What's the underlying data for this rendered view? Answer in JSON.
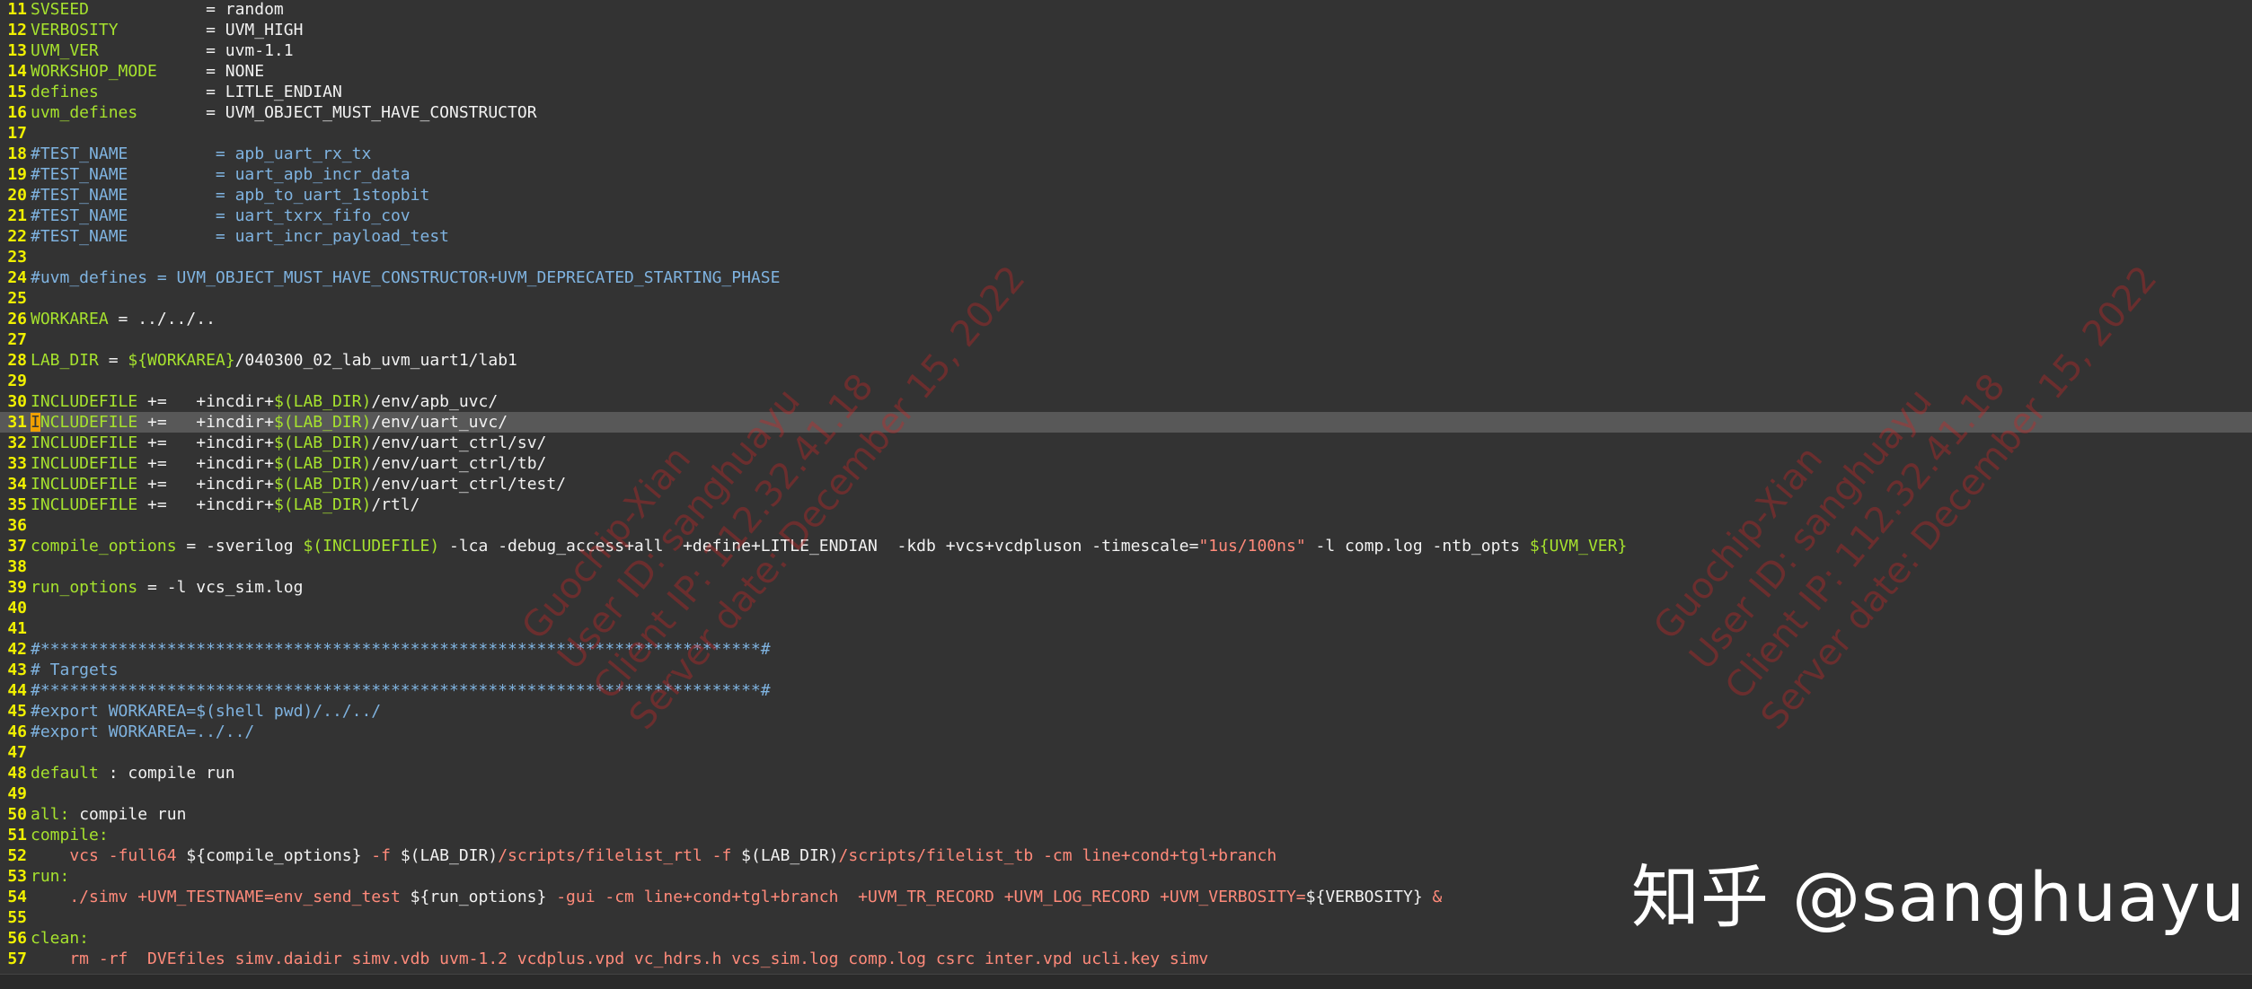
{
  "editor": {
    "cursor_line": 31,
    "lines": [
      {
        "n": "11",
        "segs": [
          [
            "k",
            "SVSEED"
          ],
          [
            "w",
            "            = random"
          ]
        ]
      },
      {
        "n": "12",
        "segs": [
          [
            "k",
            "VERBOSITY"
          ],
          [
            "w",
            "         = UVM_HIGH"
          ]
        ]
      },
      {
        "n": "13",
        "segs": [
          [
            "k",
            "UVM_VER"
          ],
          [
            "w",
            "           = uvm-1.1"
          ]
        ]
      },
      {
        "n": "14",
        "segs": [
          [
            "k",
            "WORKSHOP_MODE"
          ],
          [
            "w",
            "     = NONE"
          ]
        ]
      },
      {
        "n": "15",
        "segs": [
          [
            "k",
            "defines"
          ],
          [
            "w",
            "           = LITLE_ENDIAN"
          ]
        ]
      },
      {
        "n": "16",
        "segs": [
          [
            "k",
            "uvm_defines"
          ],
          [
            "w",
            "       = UVM_OBJECT_MUST_HAVE_CONSTRUCTOR"
          ]
        ]
      },
      {
        "n": "17",
        "segs": []
      },
      {
        "n": "18",
        "segs": [
          [
            "c",
            "#TEST_NAME         = apb_uart_rx_tx"
          ]
        ]
      },
      {
        "n": "19",
        "segs": [
          [
            "c",
            "#TEST_NAME         = uart_apb_incr_data"
          ]
        ]
      },
      {
        "n": "20",
        "segs": [
          [
            "c",
            "#TEST_NAME         = apb_to_uart_1stopbit"
          ]
        ]
      },
      {
        "n": "21",
        "segs": [
          [
            "c",
            "#TEST_NAME         = uart_txrx_fifo_cov"
          ]
        ]
      },
      {
        "n": "22",
        "segs": [
          [
            "c",
            "#TEST_NAME         = uart_incr_payload_test"
          ]
        ]
      },
      {
        "n": "23",
        "segs": []
      },
      {
        "n": "24",
        "segs": [
          [
            "c",
            "#uvm_defines = UVM_OBJECT_MUST_HAVE_CONSTRUCTOR+UVM_DEPRECATED_STARTING_PHASE"
          ]
        ]
      },
      {
        "n": "25",
        "segs": []
      },
      {
        "n": "26",
        "segs": [
          [
            "k",
            "WORKAREA"
          ],
          [
            "w",
            " = ../../.."
          ]
        ]
      },
      {
        "n": "27",
        "segs": []
      },
      {
        "n": "28",
        "segs": [
          [
            "k",
            "LAB_DIR"
          ],
          [
            "w",
            " = "
          ],
          [
            "v",
            "${WORKAREA}"
          ],
          [
            "w",
            "/040300_02_lab_uvm_uart1/lab1"
          ]
        ]
      },
      {
        "n": "29",
        "segs": []
      },
      {
        "n": "30",
        "segs": [
          [
            "k",
            "INCLUDEFILE"
          ],
          [
            "w",
            " +=   +incdir+"
          ],
          [
            "v",
            "$(LAB_DIR)"
          ],
          [
            "w",
            "/env/apb_uvc/"
          ]
        ]
      },
      {
        "n": "31",
        "segs": [
          [
            "cursor",
            "I"
          ],
          [
            "k",
            "NCLUDEFILE"
          ],
          [
            "w",
            " +=   +incdir+"
          ],
          [
            "v",
            "$(LAB_DIR)"
          ],
          [
            "w",
            "/env/uart_uvc/"
          ]
        ]
      },
      {
        "n": "32",
        "segs": [
          [
            "k",
            "INCLUDEFILE"
          ],
          [
            "w",
            " +=   +incdir+"
          ],
          [
            "v",
            "$(LAB_DIR)"
          ],
          [
            "w",
            "/env/uart_ctrl/sv/"
          ]
        ]
      },
      {
        "n": "33",
        "segs": [
          [
            "k",
            "INCLUDEFILE"
          ],
          [
            "w",
            " +=   +incdir+"
          ],
          [
            "v",
            "$(LAB_DIR)"
          ],
          [
            "w",
            "/env/uart_ctrl/tb/"
          ]
        ]
      },
      {
        "n": "34",
        "segs": [
          [
            "k",
            "INCLUDEFILE"
          ],
          [
            "w",
            " +=   +incdir+"
          ],
          [
            "v",
            "$(LAB_DIR)"
          ],
          [
            "w",
            "/env/uart_ctrl/test/"
          ]
        ]
      },
      {
        "n": "35",
        "segs": [
          [
            "k",
            "INCLUDEFILE"
          ],
          [
            "w",
            " +=   +incdir+"
          ],
          [
            "v",
            "$(LAB_DIR)"
          ],
          [
            "w",
            "/rtl/"
          ]
        ]
      },
      {
        "n": "36",
        "segs": []
      },
      {
        "n": "37",
        "segs": [
          [
            "k",
            "compile_options"
          ],
          [
            "w",
            " = -sverilog "
          ],
          [
            "v",
            "$(INCLUDEFILE)"
          ],
          [
            "w",
            " -lca -debug_access+all  +define+LITLE_ENDIAN  -kdb +vcs+vcdpluson -timescale="
          ],
          [
            "s",
            "\"1us/100ns\""
          ],
          [
            "w",
            " -l comp.log -ntb_opts "
          ],
          [
            "v",
            "${UVM_VER}"
          ]
        ]
      },
      {
        "n": "38",
        "segs": []
      },
      {
        "n": "39",
        "segs": [
          [
            "k",
            "run_options"
          ],
          [
            "w",
            " = -l vcs_sim.log"
          ]
        ]
      },
      {
        "n": "40",
        "segs": []
      },
      {
        "n": "41",
        "segs": []
      },
      {
        "n": "42",
        "segs": [
          [
            "c",
            "#**************************************************************************#"
          ]
        ]
      },
      {
        "n": "43",
        "segs": [
          [
            "c",
            "# Targets"
          ]
        ]
      },
      {
        "n": "44",
        "segs": [
          [
            "c",
            "#**************************************************************************#"
          ]
        ]
      },
      {
        "n": "45",
        "segs": [
          [
            "c",
            "#export WORKAREA=$(shell pwd)/../../"
          ]
        ]
      },
      {
        "n": "46",
        "segs": [
          [
            "c",
            "#export WORKAREA=../../"
          ]
        ]
      },
      {
        "n": "47",
        "segs": []
      },
      {
        "n": "48",
        "segs": [
          [
            "k",
            "default"
          ],
          [
            "w",
            " : compile run"
          ]
        ]
      },
      {
        "n": "49",
        "segs": []
      },
      {
        "n": "50",
        "segs": [
          [
            "k",
            "all:"
          ],
          [
            "w",
            " compile run"
          ]
        ]
      },
      {
        "n": "51",
        "segs": [
          [
            "k",
            "compile:"
          ]
        ]
      },
      {
        "n": "52",
        "segs": [
          [
            "r",
            "    vcs -full64 "
          ],
          [
            "w",
            "${compile_options}"
          ],
          [
            "r",
            " -f "
          ],
          [
            "w",
            "$(LAB_DIR)"
          ],
          [
            "r",
            "/scripts/filelist_rtl -f "
          ],
          [
            "w",
            "$(LAB_DIR)"
          ],
          [
            "r",
            "/scripts/filelist_tb -cm line+cond+tgl+branch"
          ]
        ]
      },
      {
        "n": "53",
        "segs": [
          [
            "k",
            "run:"
          ]
        ]
      },
      {
        "n": "54",
        "segs": [
          [
            "r",
            "    ./simv +UVM_TESTNAME=env_send_test "
          ],
          [
            "w",
            "${run_options}"
          ],
          [
            "r",
            " -gui -cm line+cond+tgl+branch  +UVM_TR_RECORD +UVM_LOG_RECORD +UVM_VERBOSITY="
          ],
          [
            "w",
            "${VERBOSITY}"
          ],
          [
            "r",
            " &"
          ]
        ]
      },
      {
        "n": "55",
        "segs": []
      },
      {
        "n": "56",
        "segs": [
          [
            "k",
            "clean:"
          ]
        ]
      },
      {
        "n": "57",
        "segs": [
          [
            "r",
            "    rm -rf  DVEfiles simv.daidir simv.vdb uvm-1.2 vcdplus.vpd vc_hdrs.h vcs_sim.log comp.log csrc inter.vpd ucli.key simv"
          ]
        ]
      }
    ]
  },
  "overlay": {
    "watermark": "知乎 @sanghuayu",
    "stamp_lines": [
      "Guochip-Xian",
      "User ID: sanghuayu",
      "Client IP: 112.32.41.18",
      "Server date: December 15, 2022"
    ]
  },
  "colors": {
    "background": "#333333",
    "line_number": "#f0f000",
    "variable": "#a6e22e",
    "comment": "#7fb3e0",
    "string": "#ff8a7a",
    "current_line": "#585858",
    "stamp": "#c82828"
  }
}
